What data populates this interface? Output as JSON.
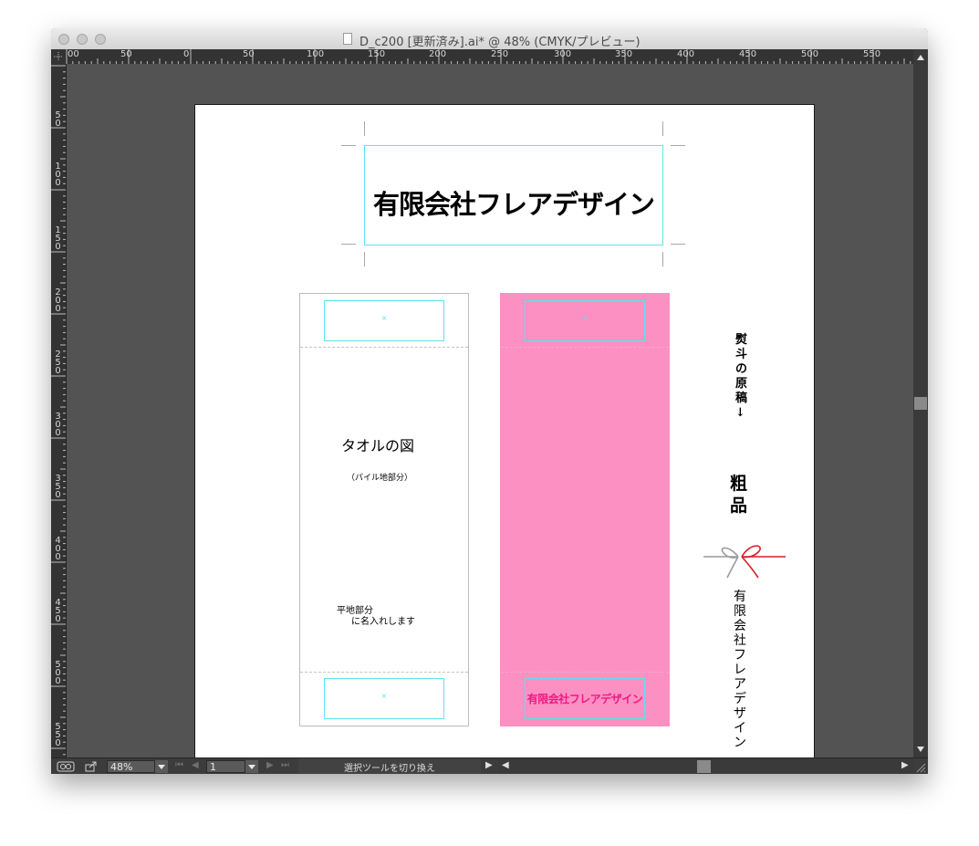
{
  "window": {
    "title": "D_c200 [更新済み].ai* @ 48% (CMYK/プレビュー)"
  },
  "rulers": {
    "horizontal": [
      "00",
      "50",
      "0",
      "50",
      "100",
      "150",
      "200",
      "250",
      "300",
      "350",
      "400",
      "450",
      "500",
      "550"
    ],
    "vertical": [
      "5\n0",
      "1\n0\n0",
      "1\n5\n0",
      "2\n0\n0",
      "2\n5\n0",
      "3\n0\n0",
      "3\n5\n0",
      "4\n0\n0",
      "4\n5\n0",
      "5\n0\n0",
      "5\n5\n0"
    ]
  },
  "artwork": {
    "logo_text": "有限会社フレアデザイン",
    "towel_white": {
      "marker_top": "×",
      "marker_bottom": "×",
      "title": "タオルの図",
      "subtitle": "（パイル地部分）",
      "note_line1": "平地部分",
      "note_line2": "に名入れします"
    },
    "towel_pink": {
      "marker_top": "×",
      "name_text": "有限会社フレアデザイン",
      "fill_color": "#fc90c2",
      "text_color": "#ef1a83"
    },
    "noshi": {
      "heading": "熨斗の原稿↓",
      "gift_label": "粗品",
      "company": "有限会社フレアデザイン"
    },
    "guide_color": "#5fe3ee"
  },
  "statusbar": {
    "zoom": "48%",
    "artboard_number": "1",
    "tool_status": "選択ツールを切り換え"
  }
}
